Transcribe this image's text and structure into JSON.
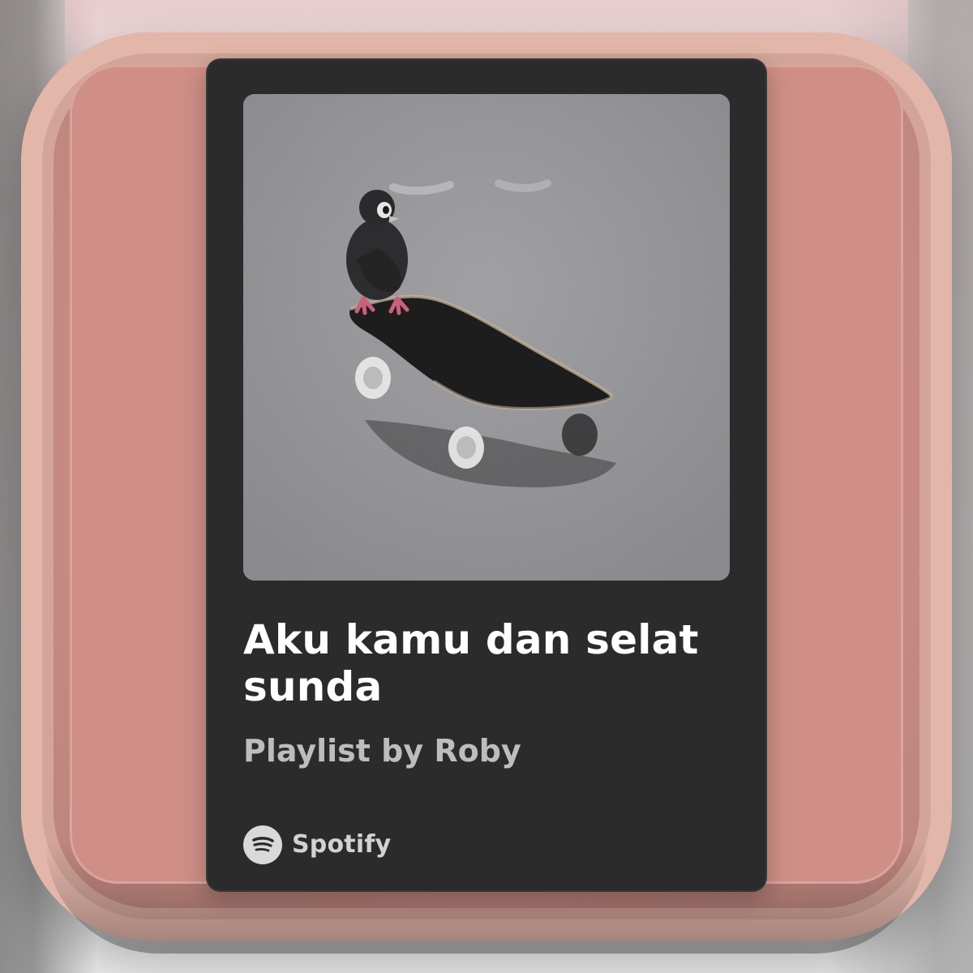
{
  "playlist_card": {
    "title": "Aku kamu dan selat sunda",
    "subtitle": "Playlist by Roby",
    "brand": {
      "name": "Spotify",
      "icon": "spotify-logo-icon"
    },
    "artwork": {
      "icon": "artwork-image"
    }
  },
  "colors": {
    "card_bg": "#2b2b2b",
    "title": "#ffffff",
    "subtitle": "#bdbdbd",
    "brand": "#d2d2d2",
    "background_panel": "#cf8f86"
  }
}
